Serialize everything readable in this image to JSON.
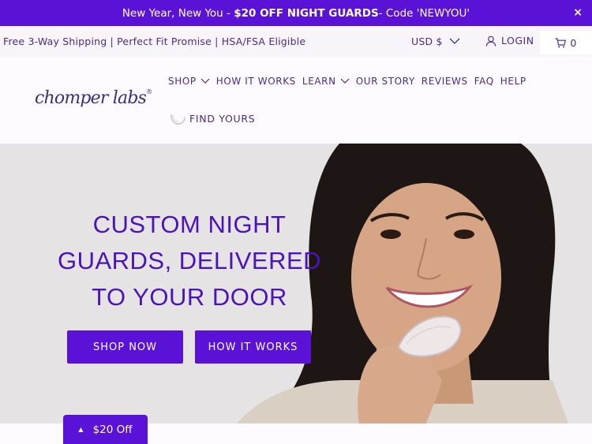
{
  "announcement": {
    "prefix": "New Year, New You - ",
    "highlight": "$20 OFF NIGHT GUARDS",
    "suffix": "- Code 'NEWYOU'",
    "close": "×"
  },
  "utility": {
    "promise": "Free 3-Way Shipping | Perfect Fit Promise | HSA/FSA Eligible",
    "currency": "USD $",
    "login": "LOGIN",
    "cart_count": "0"
  },
  "header": {
    "logo": "chomper labs",
    "logo_mark": "®",
    "nav": [
      {
        "label": "SHOP",
        "dropdown": true
      },
      {
        "label": "HOW IT WORKS",
        "dropdown": false
      },
      {
        "label": "LEARN",
        "dropdown": true
      },
      {
        "label": "OUR STORY",
        "dropdown": false
      },
      {
        "label": "REVIEWS",
        "dropdown": false
      },
      {
        "label": "FAQ",
        "dropdown": false
      },
      {
        "label": "HELP",
        "dropdown": false
      }
    ],
    "find_yours": "FIND YOURS"
  },
  "hero": {
    "headline_lines": [
      "CUSTOM NIGHT",
      "GUARDS, DELIVERED",
      "TO YOUR DOOR"
    ],
    "shop_button": "SHOP NOW",
    "how_button": "HOW IT WORKS"
  },
  "offer": {
    "label": "$20 Off",
    "icon": "▲"
  },
  "colors": {
    "brand": "#5a13d6",
    "heading": "#4a14b8",
    "nav_text": "#4a2c86",
    "hero_bg": "#e6e3e5"
  }
}
